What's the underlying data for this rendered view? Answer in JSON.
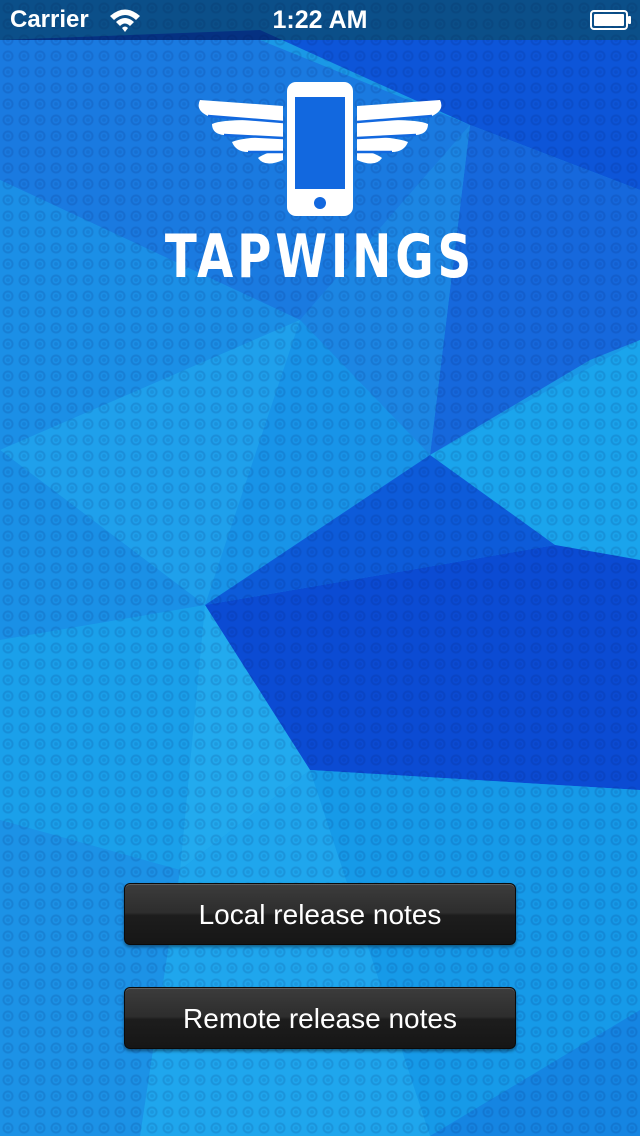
{
  "status_bar": {
    "carrier": "Carrier",
    "time": "1:22 AM",
    "wifi_icon": "wifi-icon",
    "battery_icon": "battery-icon"
  },
  "app": {
    "brand_name": "TAPWINGS",
    "logo_icon": "winged-phone-logo"
  },
  "buttons": {
    "local": "Local release notes",
    "remote": "Remote release notes"
  },
  "colors": {
    "background_light": "#1aa3ea",
    "background_dark": "#0a3fd6",
    "button": "#2a2a2a",
    "text": "#ffffff"
  }
}
